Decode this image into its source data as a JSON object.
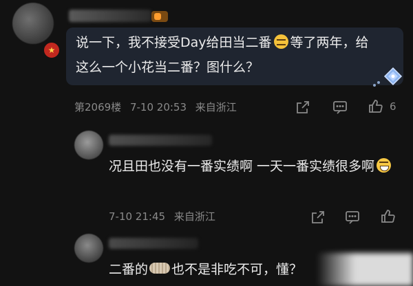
{
  "comments": [
    {
      "text_part1": "说一下，我不接受Day给田当二番",
      "emoji": "smirk-emoji",
      "text_part2": "等了两年，给这么一个小花当二番？图什么？",
      "floor": "第2069楼",
      "time": "7-10 20:53",
      "location": "来自浙江",
      "likes": "6",
      "fan_badge": "铁粉标签"
    },
    {
      "text_part1": "况且田也没有一番实绩啊 一天一番实绩很多啊",
      "emoji": "laughing-emoji",
      "time": "7-10 21:45",
      "location": "来自浙江"
    },
    {
      "text_part1": "二番的",
      "sticker": "cookie-sticker",
      "text_part2": "也不是非吃不可，懂？"
    }
  ],
  "icons": {
    "share": "share-icon",
    "reply": "comment-icon",
    "like": "thumbs-up-icon",
    "member": "diamond-badge-icon",
    "verified": "star-badge-icon"
  },
  "colors": {
    "background": "#121212",
    "bubble": "#1f2530",
    "text": "#ececec",
    "meta": "#8a8a8a",
    "fan_badge": "#7a4a12"
  }
}
